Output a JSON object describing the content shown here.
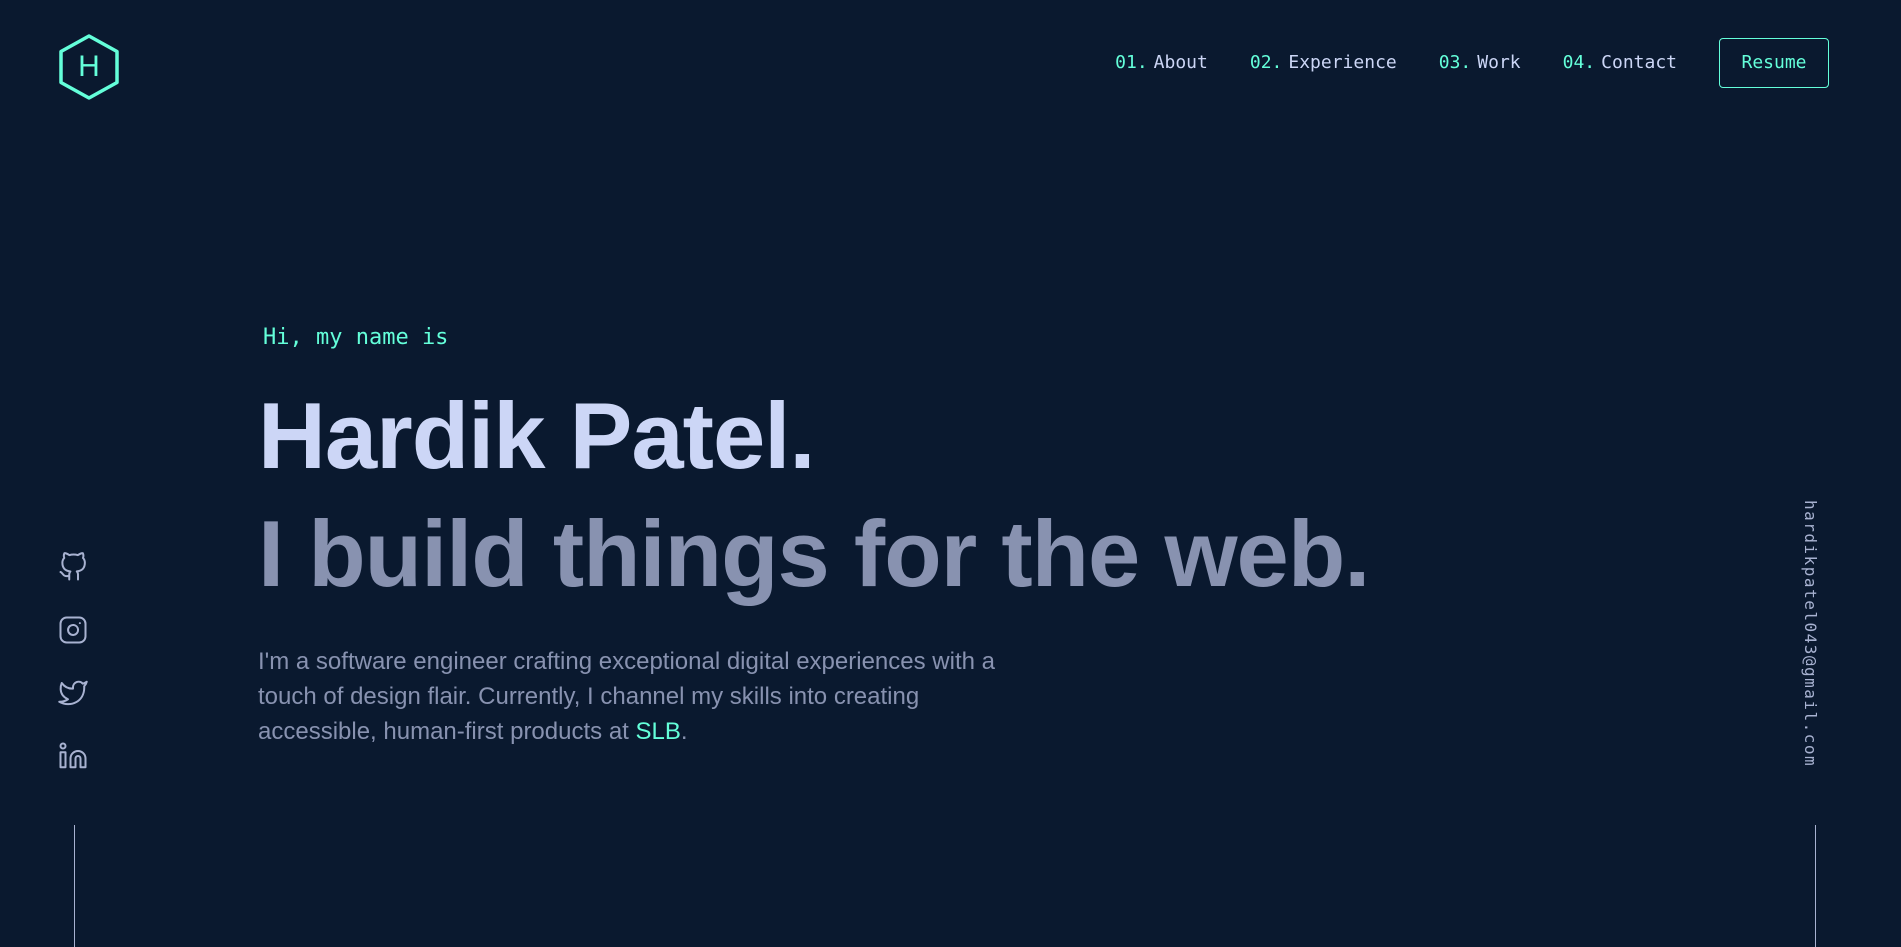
{
  "header": {
    "logo_letter": "H",
    "nav": [
      {
        "num": "01.",
        "label": "About"
      },
      {
        "num": "02.",
        "label": "Experience"
      },
      {
        "num": "03.",
        "label": "Work"
      },
      {
        "num": "04.",
        "label": "Contact"
      }
    ],
    "resume_label": "Resume"
  },
  "hero": {
    "greeting": "Hi, my name is",
    "name": "Hardik Patel.",
    "tagline": "I build things for the web.",
    "description_prefix": "I'm a software engineer crafting exceptional digital experiences with a touch of design flair. Currently, I channel my skills into creating accessible, human-first products at ",
    "company": "SLB",
    "description_suffix": "."
  },
  "socials": [
    {
      "icon": "github-icon"
    },
    {
      "icon": "instagram-icon"
    },
    {
      "icon": "twitter-icon"
    },
    {
      "icon": "linkedin-icon"
    }
  ],
  "email": "hardikpatel043@gmail.com",
  "colors": {
    "background": "#0a192f",
    "accent": "#64ffda",
    "heading": "#ccd6f6",
    "body_text": "#8892b0",
    "light_text": "#a8b2d1"
  }
}
